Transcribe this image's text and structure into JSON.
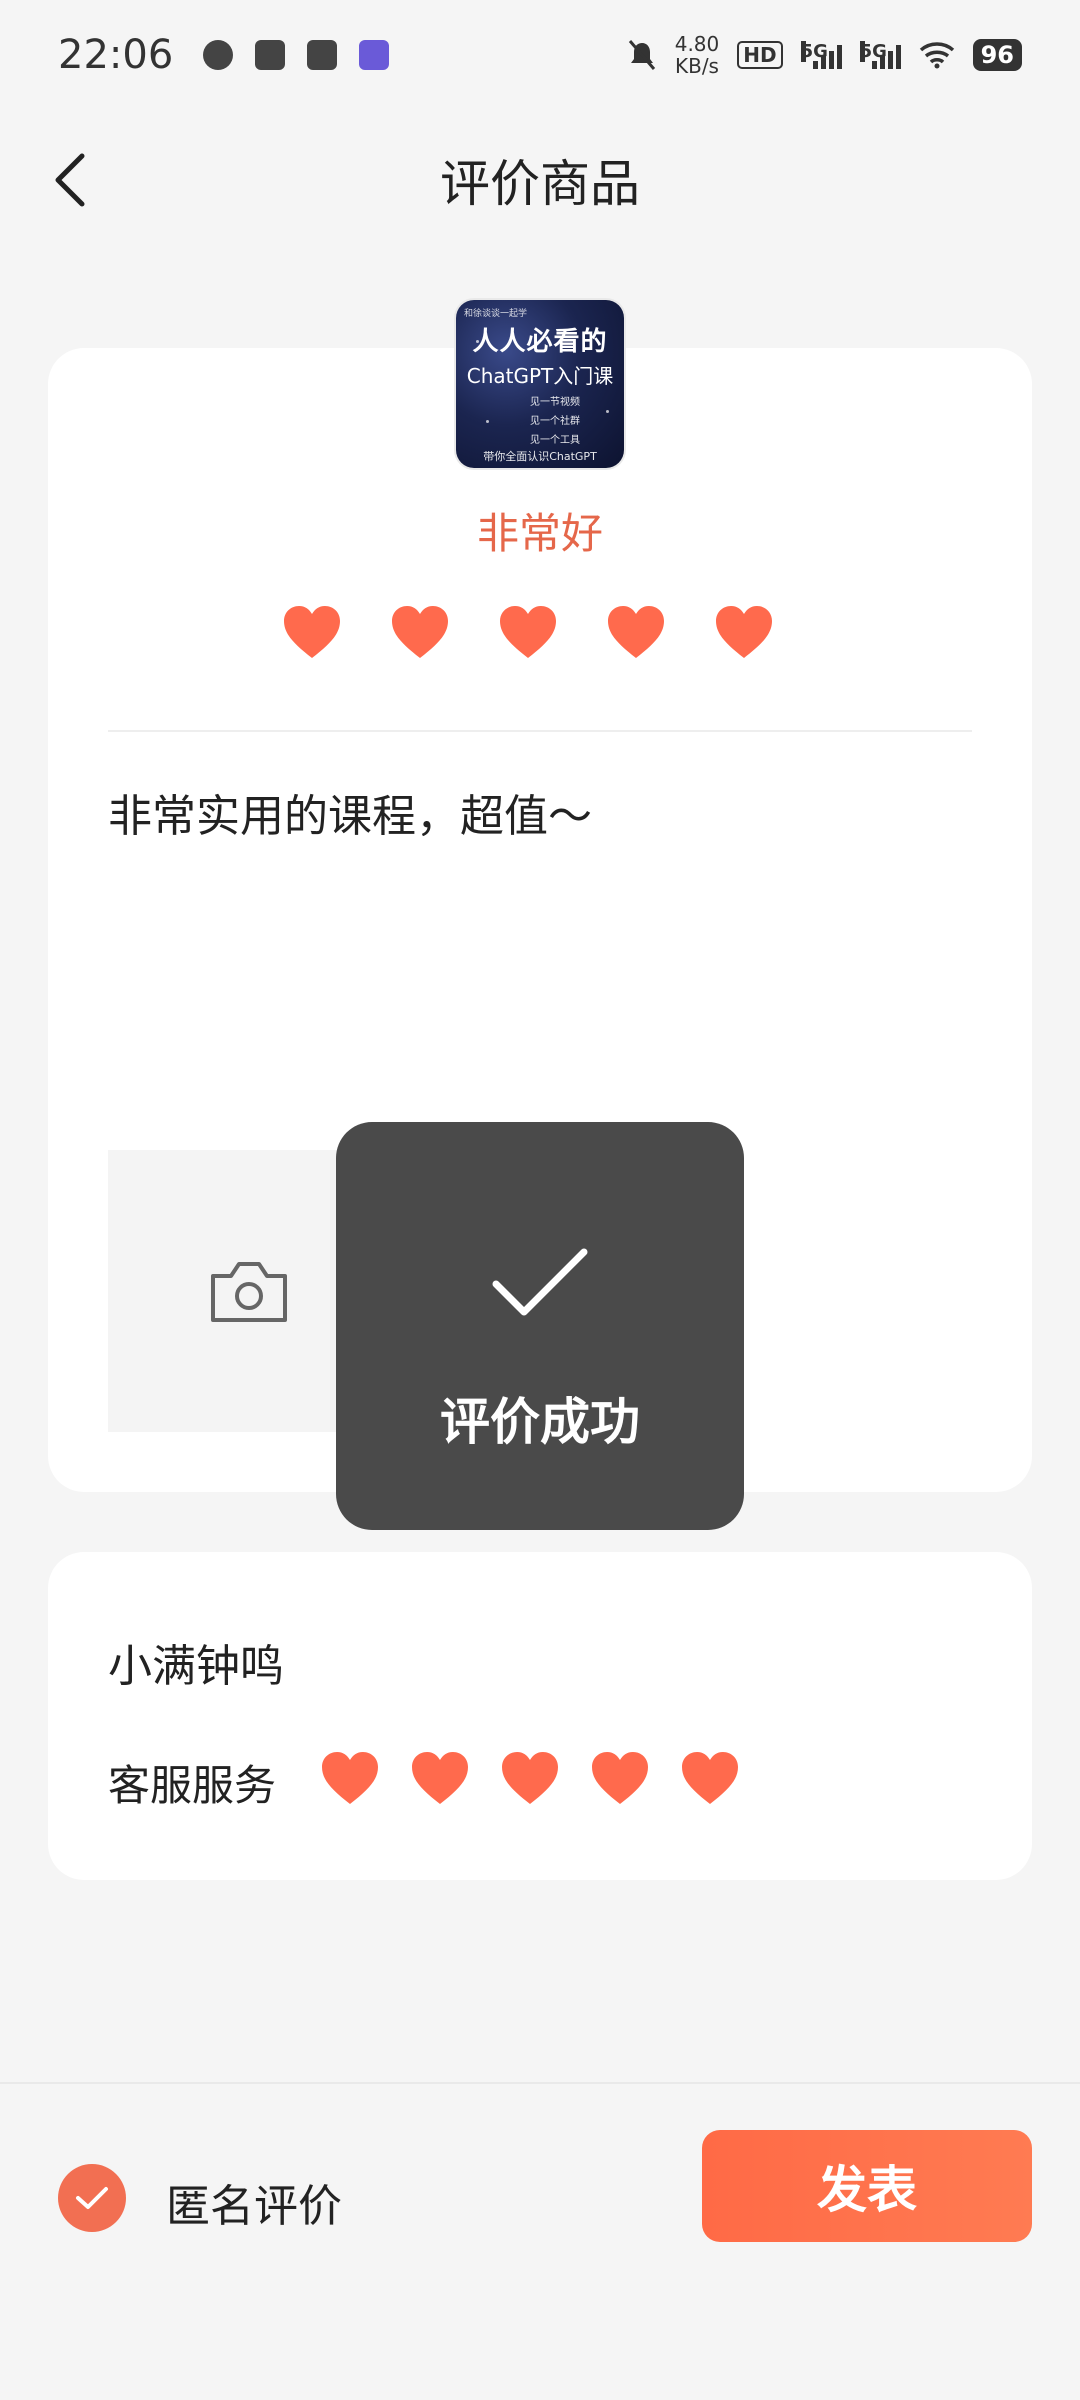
{
  "status_bar": {
    "time": "22:06",
    "speed_value": "4.80",
    "speed_unit": "KB/s",
    "hd_label": "HD",
    "sim1_label": "5G",
    "sim2_label": "5G",
    "battery": "96"
  },
  "header": {
    "title": "评价商品"
  },
  "product": {
    "thumb_top": "和徐谈谈一起学",
    "thumb_title": "人人必看的",
    "thumb_subtitle": "ChatGPT入门课",
    "thumb_lines": [
      "见一节视频",
      "见一个社群",
      "见一个工具"
    ],
    "thumb_bottom": "带你全面认识ChatGPT"
  },
  "rating": {
    "label": "非常好",
    "hearts": 5,
    "max": 5,
    "color": "#ff6a4d"
  },
  "review": {
    "text": "非常实用的课程，超值～"
  },
  "toast": {
    "text": "评价成功"
  },
  "seller": {
    "name": "小满钟鸣",
    "service_label": "客服服务",
    "service_hearts": 5
  },
  "footer": {
    "anonymous_label": "匿名评价",
    "anonymous_checked": true,
    "publish_label": "发表",
    "accent_color": "#ff6a46"
  }
}
